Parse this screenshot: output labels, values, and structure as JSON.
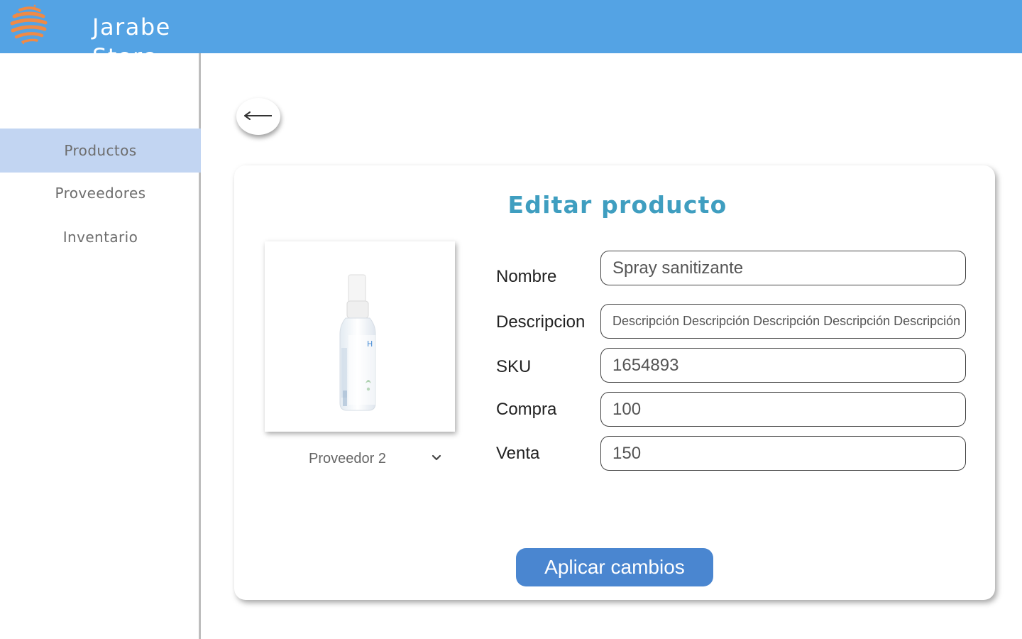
{
  "header": {
    "logo_icon": "orange-sphere-logo",
    "brand": "Jarabe Store",
    "colors": {
      "bar": "#54a3e4",
      "logo": "#f08a45"
    }
  },
  "sidebar": {
    "items": [
      {
        "label": "Productos",
        "active": true
      },
      {
        "label": "Proveedores",
        "active": false
      },
      {
        "label": "Inventario",
        "active": false
      }
    ],
    "active_color": "#c2d5f2"
  },
  "back_button": {
    "icon": "arrow-left-icon"
  },
  "form": {
    "title": "Editar producto",
    "product_image": "spray-bottle-image",
    "supplier": {
      "selected": "Proveedor 2",
      "icon": "chevron-down-icon"
    },
    "fields": [
      {
        "label": "Nombre",
        "value": "Spray sanitizante"
      },
      {
        "label": "Descripcion",
        "value": "Descripción Descripción Descripción Descripción Descripción"
      },
      {
        "label": "SKU",
        "value": "1654893"
      },
      {
        "label": "Compra",
        "value": "100"
      },
      {
        "label": "Venta",
        "value": "150"
      }
    ],
    "apply_label": "Aplicar cambios",
    "colors": {
      "title": "#3f9ec0",
      "button": "#4a86d0"
    }
  }
}
